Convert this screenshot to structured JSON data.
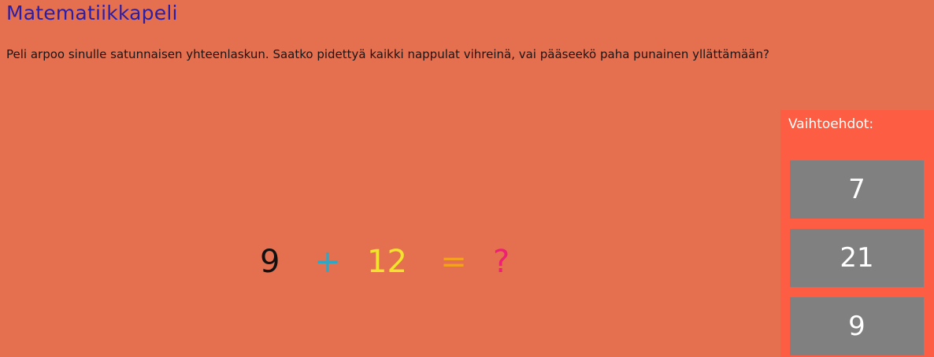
{
  "page": {
    "title": "Matematiikkapeli",
    "intro": "Peli arpoo sinulle satunnaisen yhteenlaskun. Saatko pidettyä kaikki nappulat vihreinä, vai pääseekö paha punainen yllättämään?"
  },
  "equation": {
    "a": "9",
    "plus": "+",
    "b": "12",
    "equals": "=",
    "unknown": "?"
  },
  "options": {
    "heading": "Vaihtoehdot:",
    "items": [
      "7",
      "21",
      "9"
    ]
  },
  "colors": {
    "background": "#e5704f",
    "panel": "#fd5e43",
    "button": "#808080",
    "title": "#2b1ea6",
    "plus": "#31a6c3",
    "second_number": "#f2e32c",
    "equals": "#f6a01f",
    "unknown": "#ee1f74"
  }
}
